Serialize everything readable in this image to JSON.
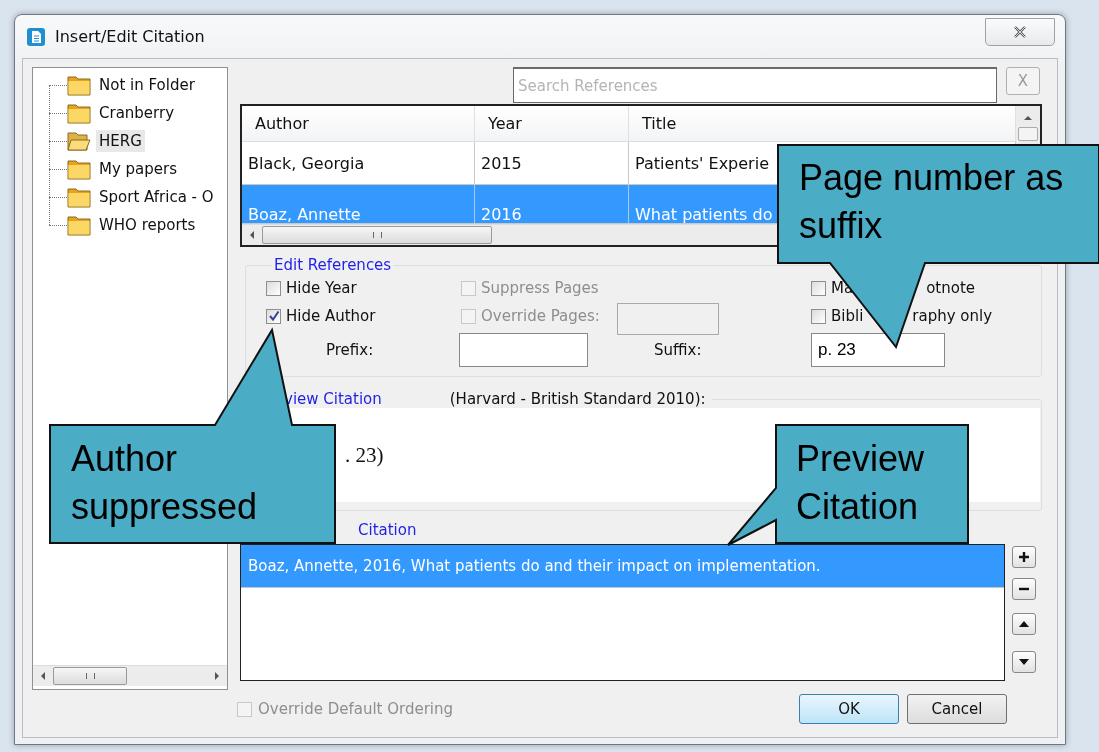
{
  "window": {
    "title": "Insert/Edit Citation"
  },
  "folders": [
    {
      "label": "Not in Folder",
      "selected": false
    },
    {
      "label": "Cranberry",
      "selected": false
    },
    {
      "label": "HERG",
      "selected": true
    },
    {
      "label": "My papers",
      "selected": false
    },
    {
      "label": "Sport Africa - O",
      "selected": false
    },
    {
      "label": "WHO reports",
      "selected": false
    }
  ],
  "search": {
    "placeholder": "Search References",
    "clear_label": "X"
  },
  "table": {
    "columns": [
      "Author",
      "Year",
      "Title"
    ],
    "rows": [
      {
        "cells": [
          "Black, Georgia",
          "2015",
          "Patients' Experie"
        ],
        "selected": false
      },
      {
        "cells": [
          "Boaz, Annette",
          "2016",
          "What patients do"
        ],
        "selected": true
      }
    ]
  },
  "edit_references": {
    "legend": "Edit References",
    "columns": [
      [
        {
          "label_parts": [
            "Hide Year"
          ],
          "checked": false,
          "disabled": false
        },
        {
          "label_parts": [
            "Hide Author"
          ],
          "checked": true,
          "disabled": false
        }
      ],
      [
        {
          "label_parts": [
            "Suppress Pages"
          ],
          "checked": false,
          "disabled": true
        },
        {
          "label_parts": [
            "Override Pages:"
          ],
          "checked": false,
          "disabled": true
        }
      ],
      [
        {
          "label_parts": [
            "Ma",
            "otnote"
          ],
          "checked": false,
          "disabled": false
        },
        {
          "label_parts": [
            "Bibli",
            "raphy only"
          ],
          "checked": false,
          "disabled": false
        }
      ]
    ],
    "prefix": {
      "label": "Prefix:"
    },
    "suffix": {
      "label": "Suffix:",
      "value": "p. 23"
    }
  },
  "preview": {
    "legend": "view Citation",
    "style": "(Harvard - British Standard 2010):",
    "text": ". 23)"
  },
  "selected_citations": {
    "legend": "Citation",
    "items": [
      {
        "text": "Boaz, Annette, 2016, What patients do and their impact on implementation.",
        "selected": true
      }
    ]
  },
  "override_ordering": {
    "label": "Override Default Ordering",
    "checked": false,
    "disabled": true
  },
  "buttons": [
    {
      "label": "OK",
      "default": true
    },
    {
      "label": "Cancel",
      "default": false
    }
  ],
  "callouts": [
    {
      "text": "Page number as suffix",
      "kind": "down"
    },
    {
      "text": "Author suppressed",
      "kind": "up"
    },
    {
      "text": "Preview Citation",
      "kind": "left"
    }
  ]
}
